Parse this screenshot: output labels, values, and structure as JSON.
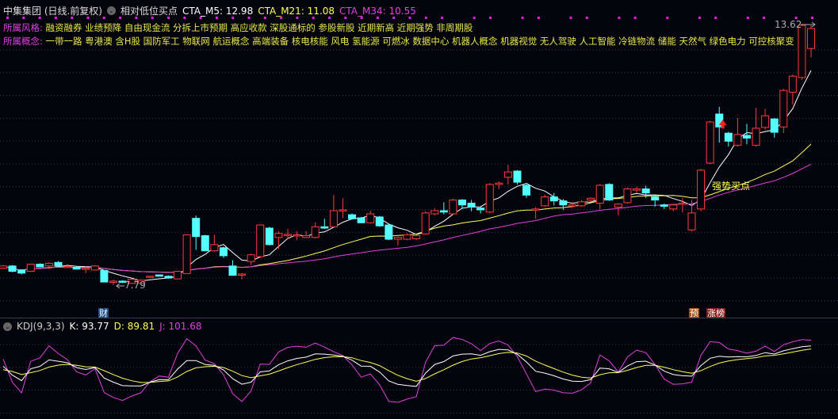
{
  "header": {
    "stock": "中集集团 (日线.前复权)",
    "indicator": "相对低位买点",
    "ma5": "CTA_M5: 12.98",
    "ma21": "CTA_M21: 11.08",
    "ma34": "CTA_M34: 10.55"
  },
  "style_row": {
    "label": "所属风格:",
    "items": "融资融券 业绩预降 自由现金流 分拆上市预期 高应收款 深股通标的 参股新股 近期新高 近期强势 非周期股"
  },
  "concept_row": {
    "label": "所属概念:",
    "items": "一带一路 粤港澳 含H股 国防军工 物联网 航运概念 高端装备 核电核能 风电 氢能源 可燃冰 数据中心 机器人概念 机器视觉 无人驾驶 人工智能 冷链物流 储能 天然气 绿色电力 可控核聚变"
  },
  "annotations": {
    "high": "13.62",
    "low": "7.79",
    "signal": "强势买点",
    "tag_fin": "财",
    "tag_pre": "预",
    "tag_rank": "涨榜"
  },
  "kdj": {
    "title": "KDJ(9,3,3)",
    "k": "K: 93.77",
    "d": "D: 89.81",
    "j": "J: 101.68"
  },
  "colors": {
    "up": "#ff3b3b",
    "down": "#54ffff",
    "ma5": "#ffffff",
    "ma21": "#ffff55",
    "ma34": "#e040e0",
    "bg": "#04040c"
  },
  "chart_data": {
    "type": "candlestick",
    "ylim": [
      7.79,
      13.62
    ],
    "candles_ochl": [
      [
        8.17,
        8.22,
        8.24,
        8.15
      ],
      [
        8.22,
        8.1,
        8.24,
        8.08
      ],
      [
        8.13,
        8.06,
        8.15,
        8.03
      ],
      [
        8.1,
        8.26,
        8.27,
        8.09
      ],
      [
        8.26,
        8.2,
        8.28,
        8.19
      ],
      [
        8.22,
        8.28,
        8.3,
        8.15
      ],
      [
        8.3,
        8.22,
        8.33,
        8.21
      ],
      [
        8.19,
        8.21,
        8.23,
        8.18
      ],
      [
        8.19,
        8.15,
        8.21,
        8.14
      ],
      [
        8.17,
        8.17,
        8.22,
        8.06
      ],
      [
        8.13,
        8.22,
        8.24,
        8.12
      ],
      [
        8.12,
        7.86,
        8.13,
        7.85
      ],
      [
        7.88,
        7.88,
        7.92,
        7.79
      ],
      [
        7.88,
        7.86,
        7.9,
        7.84
      ],
      [
        7.83,
        7.92,
        7.93,
        7.82
      ],
      [
        7.83,
        7.9,
        7.92,
        7.82
      ],
      [
        7.97,
        7.99,
        8.0,
        7.95
      ],
      [
        8.02,
        7.99,
        8.03,
        7.98
      ],
      [
        7.99,
        7.95,
        8.01,
        7.93
      ],
      [
        7.93,
        8.1,
        8.11,
        7.92
      ],
      [
        8.05,
        8.92,
        8.93,
        8.04
      ],
      [
        9.29,
        8.88,
        9.35,
        8.58
      ],
      [
        8.9,
        8.56,
        8.92,
        8.55
      ],
      [
        8.56,
        8.7,
        8.92,
        8.54
      ],
      [
        8.63,
        8.45,
        8.65,
        8.4
      ],
      [
        8.22,
        8.01,
        8.35,
        8.0
      ],
      [
        8.03,
        8.04,
        8.06,
        7.92
      ],
      [
        8.32,
        8.47,
        8.5,
        8.24
      ],
      [
        8.43,
        9.14,
        9.15,
        8.4
      ],
      [
        9.07,
        8.7,
        9.1,
        8.68
      ],
      [
        8.86,
        8.95,
        9.0,
        8.6
      ],
      [
        8.93,
        8.93,
        9.05,
        8.82
      ],
      [
        8.92,
        8.92,
        9.0,
        8.8
      ],
      [
        8.86,
        8.9,
        9.0,
        8.85
      ],
      [
        8.86,
        9.1,
        9.2,
        8.84
      ],
      [
        9.1,
        9.07,
        9.28,
        9.05
      ],
      [
        9.1,
        9.46,
        9.81,
        9.08
      ],
      [
        9.48,
        9.48,
        9.74,
        9.3
      ],
      [
        9.37,
        9.28,
        9.4,
        9.26
      ],
      [
        9.3,
        9.19,
        9.32,
        9.18
      ],
      [
        9.19,
        9.39,
        9.46,
        9.17
      ],
      [
        9.32,
        9.12,
        9.34,
        9.1
      ],
      [
        9.14,
        8.82,
        9.16,
        8.8
      ],
      [
        8.82,
        8.86,
        8.88,
        8.68
      ],
      [
        8.82,
        8.92,
        8.95,
        8.8
      ],
      [
        8.83,
        8.9,
        8.93,
        8.8
      ],
      [
        8.94,
        9.41,
        9.45,
        8.92
      ],
      [
        9.39,
        9.46,
        9.52,
        9.35
      ],
      [
        9.46,
        9.43,
        9.65,
        9.38
      ],
      [
        9.39,
        9.7,
        9.73,
        9.37
      ],
      [
        9.7,
        9.59,
        9.72,
        9.5
      ],
      [
        9.63,
        9.54,
        9.7,
        9.45
      ],
      [
        9.52,
        9.48,
        9.55,
        9.4
      ],
      [
        9.43,
        10.05,
        10.08,
        9.4
      ],
      [
        10.05,
        10.08,
        10.12,
        9.95
      ],
      [
        10.21,
        10.33,
        10.49,
        10.05
      ],
      [
        10.35,
        10.1,
        10.37,
        10.05
      ],
      [
        10.03,
        9.81,
        10.05,
        9.75
      ],
      [
        9.5,
        9.5,
        9.54,
        9.28
      ],
      [
        9.57,
        9.77,
        9.82,
        9.55
      ],
      [
        9.77,
        9.68,
        9.86,
        9.58
      ],
      [
        9.68,
        9.59,
        9.72,
        9.48
      ],
      [
        9.59,
        9.59,
        9.66,
        9.52
      ],
      [
        9.57,
        9.66,
        9.7,
        9.55
      ],
      [
        9.7,
        9.74,
        9.76,
        9.66
      ],
      [
        9.63,
        10.03,
        10.06,
        9.5
      ],
      [
        10.05,
        9.7,
        10.08,
        9.68
      ],
      [
        9.54,
        9.61,
        9.63,
        9.35
      ],
      [
        9.64,
        9.95,
        9.98,
        9.62
      ],
      [
        9.92,
        9.95,
        10.0,
        9.85
      ],
      [
        9.95,
        9.86,
        10.02,
        9.75
      ],
      [
        9.77,
        9.7,
        9.8,
        9.55
      ],
      [
        9.59,
        9.56,
        9.62,
        9.5
      ],
      [
        9.5,
        9.59,
        9.61,
        9.45
      ],
      [
        9.63,
        9.63,
        9.74,
        9.42
      ],
      [
        9.03,
        9.41,
        9.7,
        9.0
      ],
      [
        9.5,
        10.37,
        10.4,
        9.45
      ],
      [
        10.53,
        11.45,
        11.48,
        10.5
      ],
      [
        11.63,
        11.34,
        11.79,
        10.99
      ],
      [
        11.2,
        11.02,
        11.23,
        10.9
      ],
      [
        10.93,
        11.17,
        11.54,
        10.9
      ],
      [
        11.15,
        11.09,
        11.41,
        10.95
      ],
      [
        10.93,
        11.31,
        11.77,
        10.9
      ],
      [
        11.33,
        11.59,
        11.74,
        11.28
      ],
      [
        11.52,
        11.22,
        11.54,
        11.1
      ],
      [
        11.34,
        12.16,
        12.2,
        11.2
      ],
      [
        12.12,
        12.48,
        12.52,
        11.84
      ],
      [
        12.45,
        13.62,
        13.62,
        12.4
      ],
      [
        13.1,
        13.55,
        13.62,
        12.9
      ]
    ],
    "ma_periods": [
      5,
      21,
      34
    ],
    "kdj_params": [
      9,
      3,
      3
    ],
    "signal_index": 77,
    "low_index": 12,
    "high_index": 87
  }
}
